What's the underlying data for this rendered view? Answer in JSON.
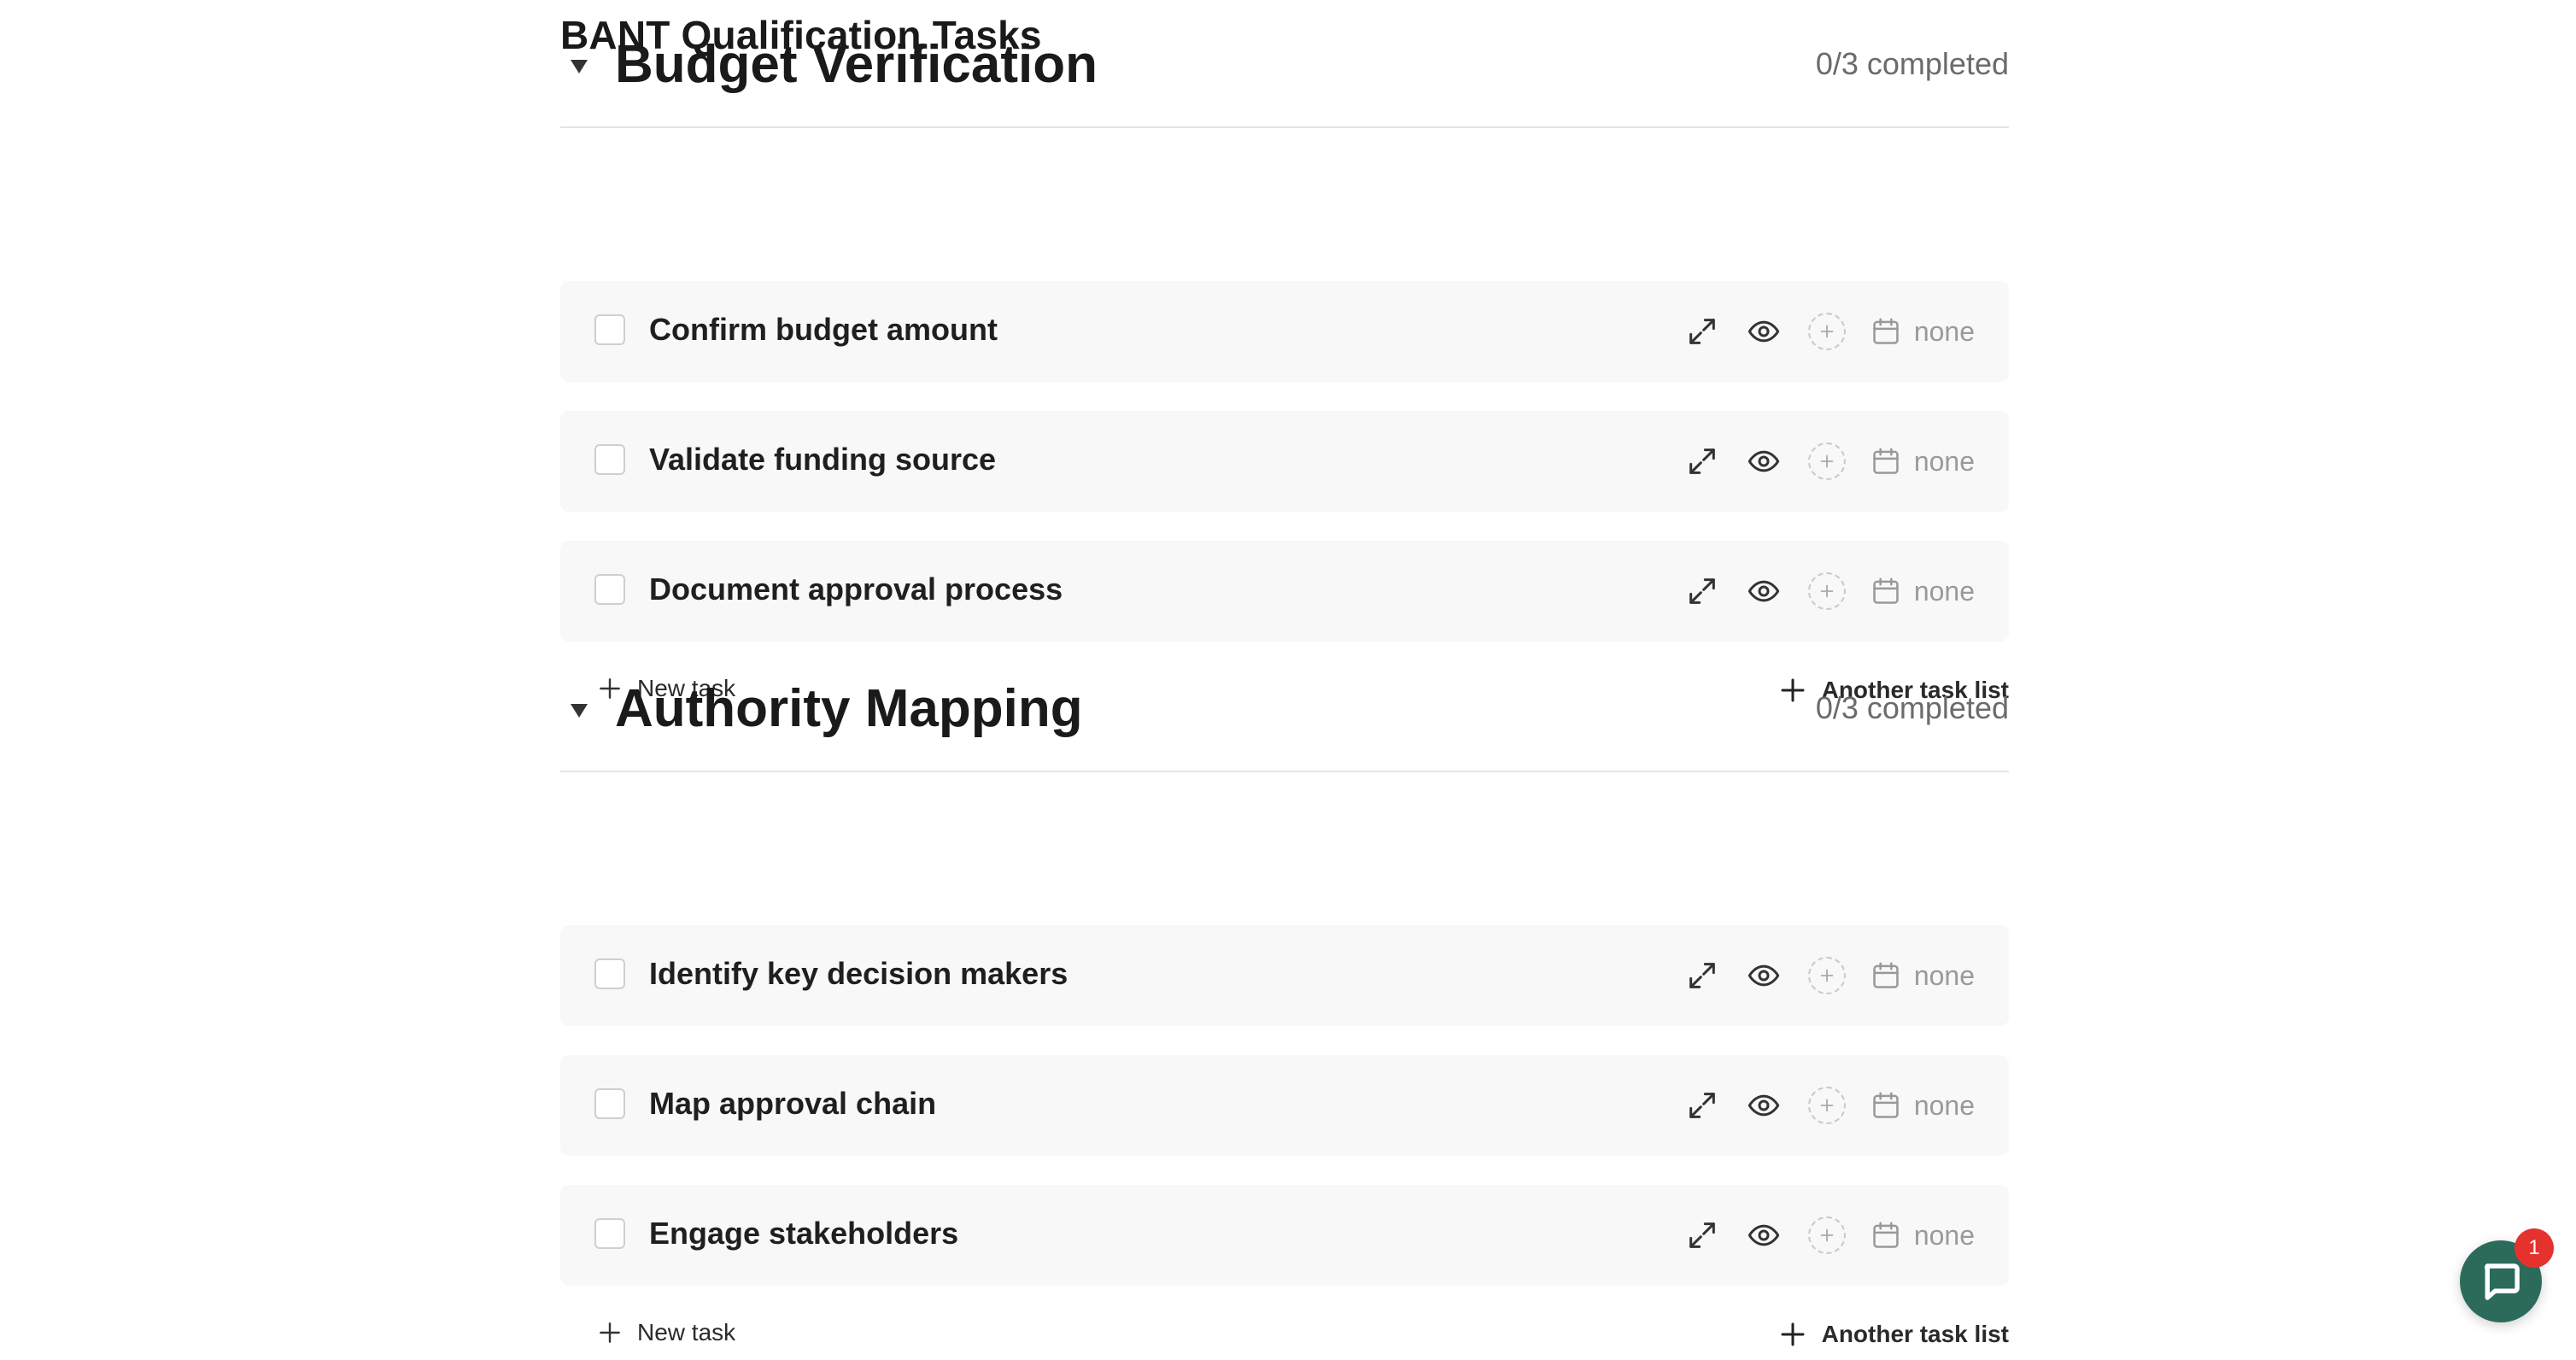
{
  "page": {
    "title": "BANT Qualification Tasks"
  },
  "icons": {
    "expand": "expand-icon",
    "view": "eye-icon",
    "add_assignee": "plus-circle-icon",
    "due_date": "calendar-icon",
    "collapse": "caret-down-icon",
    "chat": "chat-icon"
  },
  "sections": [
    {
      "title": "Budget Verification",
      "count": "0/3 completed",
      "tasks": [
        {
          "label": "Confirm budget amount",
          "due": "none"
        },
        {
          "label": "Validate funding source",
          "due": "none"
        },
        {
          "label": "Document approval process",
          "due": "none"
        }
      ],
      "new_task_label": "New task",
      "another_list_label": "Another task list"
    },
    {
      "title": "Authority Mapping",
      "count": "0/3 completed",
      "tasks": [
        {
          "label": "Identify key decision makers",
          "due": "none"
        },
        {
          "label": "Map approval chain",
          "due": "none"
        },
        {
          "label": "Engage stakeholders",
          "due": "none"
        }
      ],
      "new_task_label": "New task",
      "another_list_label": "Another task list"
    }
  ],
  "chat": {
    "badge_count": "1"
  },
  "colors": {
    "chat_bubble": "#2c6b5a",
    "badge": "#e5322d",
    "row_bg": "#f8f8f8"
  }
}
